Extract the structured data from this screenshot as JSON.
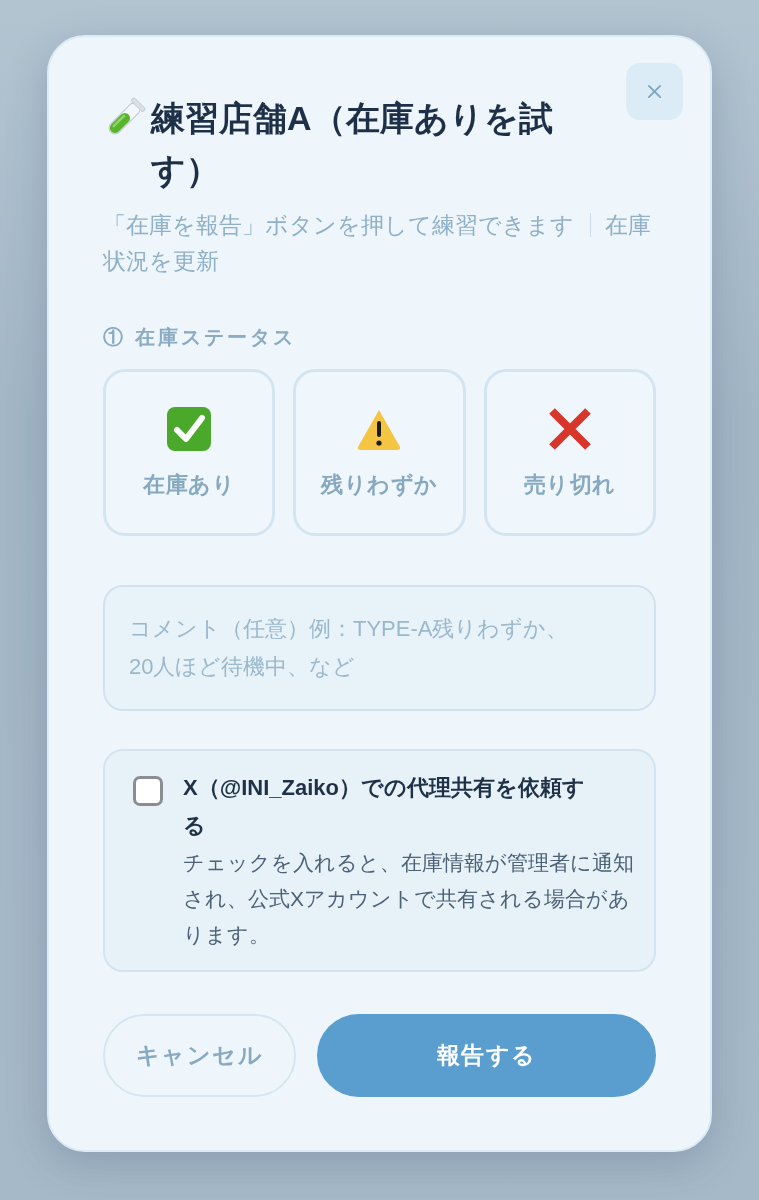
{
  "dialog": {
    "title": "練習店舗A（在庫ありを試す）",
    "subtitle": [
      "「在庫を報告」ボタンを押して練習できます",
      "在庫状況を更新"
    ]
  },
  "status_section": {
    "label": "① 在庫ステータス",
    "options": [
      {
        "kind": "in_stock",
        "label": "在庫あり",
        "selected": false
      },
      {
        "kind": "low_stock",
        "label": "残りわずか",
        "selected": false
      },
      {
        "kind": "sold_out",
        "label": "売り切れ",
        "selected": false
      }
    ]
  },
  "comment": {
    "placeholder": "コメント（任意）例：TYPE-A残りわずか、20人ほど待機中、など"
  },
  "share": {
    "checked": false,
    "label": "X（@INI_Zaiko）での代理共有を依頼する",
    "description": "チェックを入れると、在庫情報が管理者に通知され、公式Xアカウントで共有される場合があります。"
  },
  "buttons": [
    {
      "kind": "secondary",
      "label": "キャンセル"
    },
    {
      "kind": "primary",
      "label": "報告する"
    }
  ]
}
